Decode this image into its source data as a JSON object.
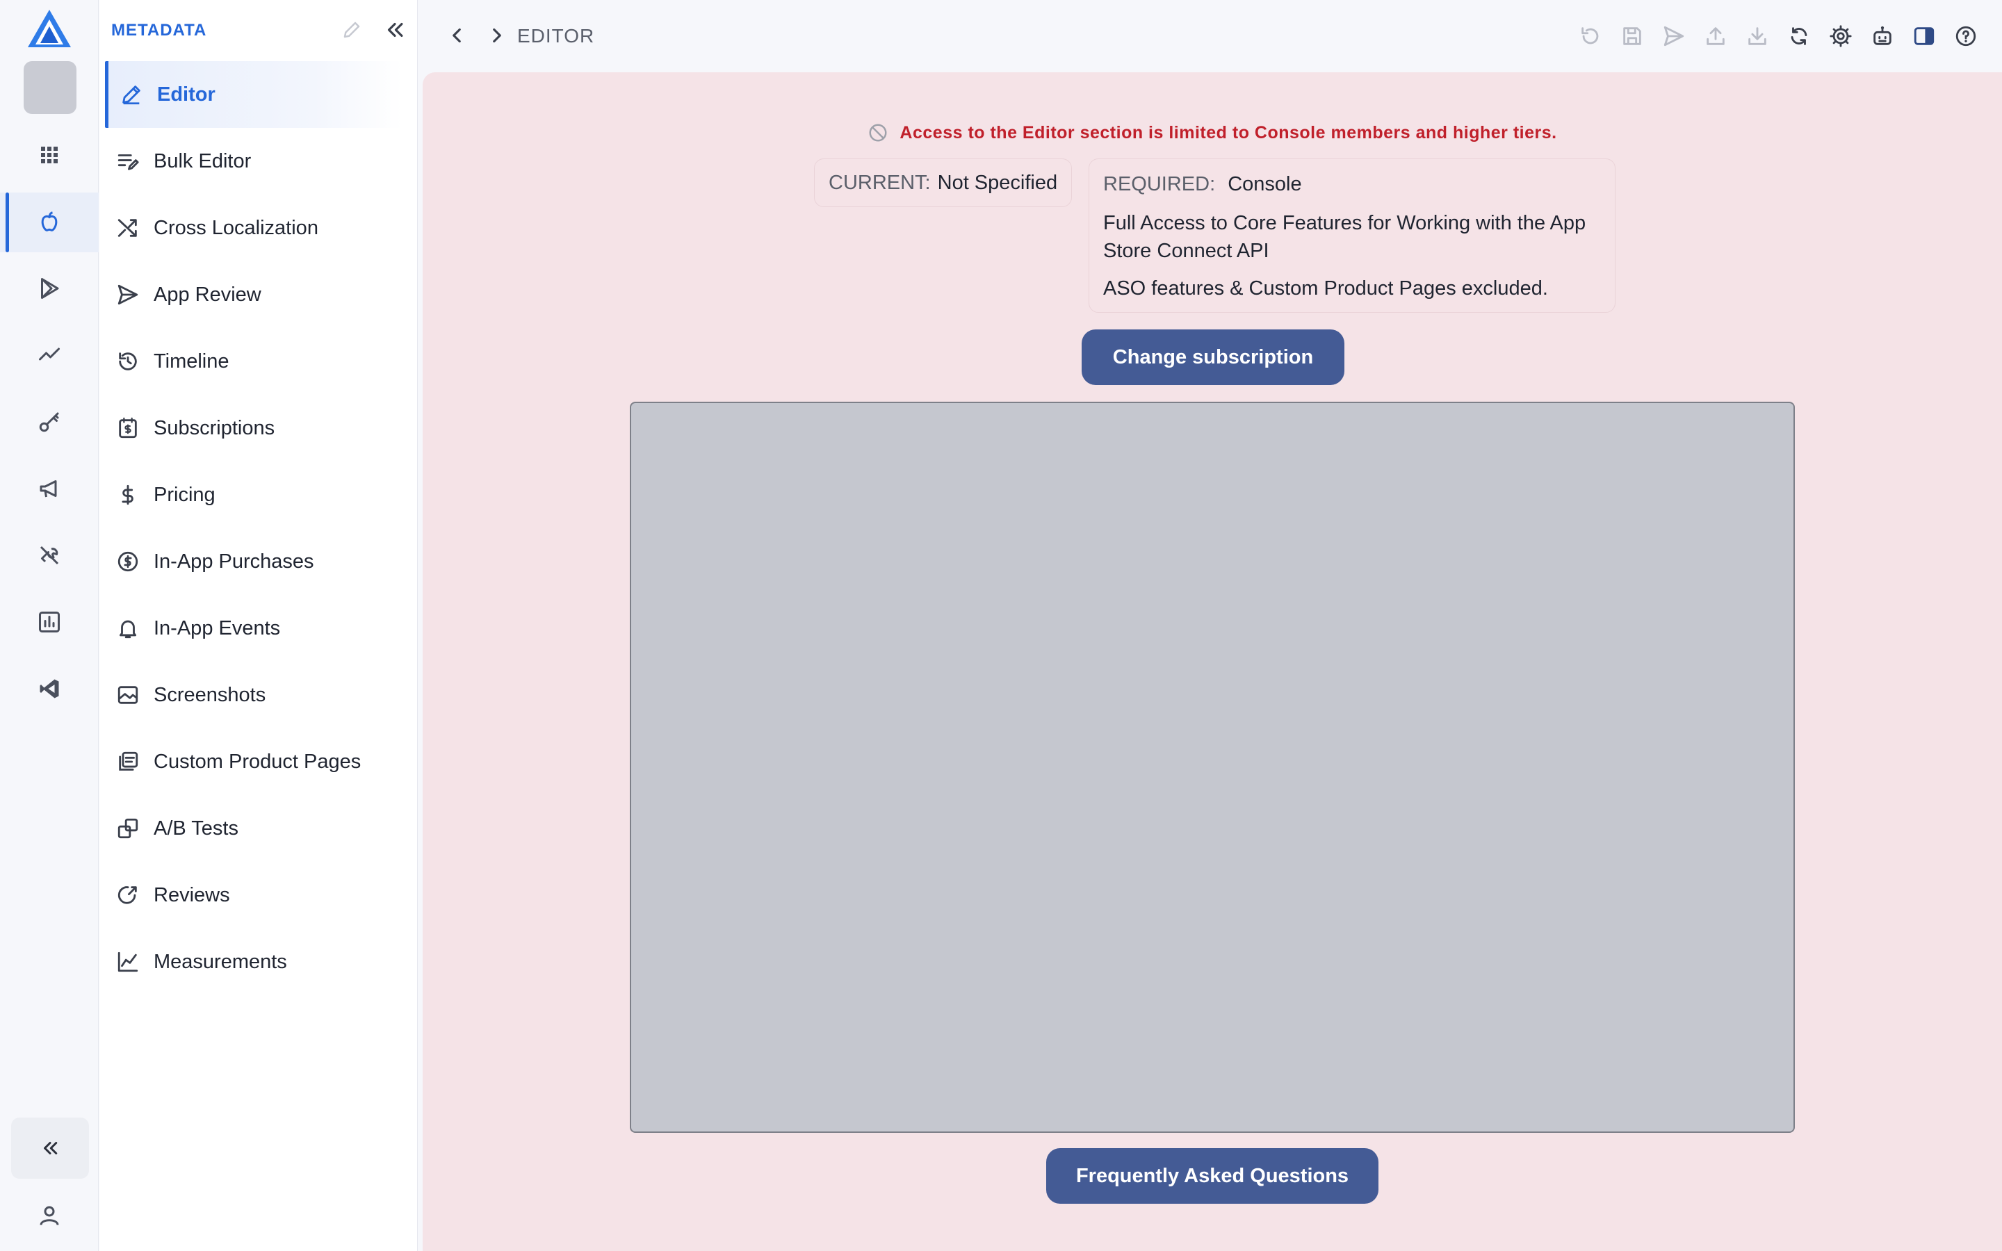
{
  "rail": {
    "logo_icon": "app-logo",
    "avatar_icon": "app-avatar-placeholder",
    "items": [
      {
        "icon": "apps-grid-icon",
        "active": false
      },
      {
        "icon": "apple-icon",
        "active": true
      },
      {
        "icon": "google-play-icon",
        "active": false
      },
      {
        "icon": "trend-icon",
        "active": false
      },
      {
        "icon": "key-icon",
        "active": false
      },
      {
        "icon": "megaphone-icon",
        "active": false
      },
      {
        "icon": "tools-icon",
        "active": false
      },
      {
        "icon": "bar-chart-icon",
        "active": false
      },
      {
        "icon": "vscode-icon",
        "active": false
      }
    ],
    "collapse_icon": "double-chevron-left-icon",
    "user_icon": "user-icon"
  },
  "sidebar": {
    "title": "METADATA",
    "items": [
      {
        "label": "Editor",
        "icon": "pencil-icon",
        "active": true
      },
      {
        "label": "Bulk Editor",
        "icon": "bulk-edit-icon",
        "active": false
      },
      {
        "label": "Cross Localization",
        "icon": "shuffle-icon",
        "active": false
      },
      {
        "label": "App Review",
        "icon": "send-icon",
        "active": false
      },
      {
        "label": "Timeline",
        "icon": "history-icon",
        "active": false
      },
      {
        "label": "Subscriptions",
        "icon": "subscriptions-icon",
        "active": false
      },
      {
        "label": "Pricing",
        "icon": "dollar-icon",
        "active": false
      },
      {
        "label": "In-App Purchases",
        "icon": "coin-icon",
        "active": false
      },
      {
        "label": "In-App Events",
        "icon": "bell-icon",
        "active": false
      },
      {
        "label": "Screenshots",
        "icon": "image-icon",
        "active": false
      },
      {
        "label": "Custom Product Pages",
        "icon": "pages-icon",
        "active": false
      },
      {
        "label": "A/B Tests",
        "icon": "ab-test-icon",
        "active": false
      },
      {
        "label": "Reviews",
        "icon": "review-icon",
        "active": false
      },
      {
        "label": "Measurements",
        "icon": "line-chart-icon",
        "active": false
      }
    ]
  },
  "topbar": {
    "breadcrumb": "EDITOR",
    "tools": [
      "undo-icon",
      "save-icon",
      "send-icon",
      "upload-icon",
      "download-icon",
      "refresh-icon",
      "settings-icon",
      "robot-icon",
      "panel-toggle-icon",
      "help-icon"
    ]
  },
  "main": {
    "alert_text": "Access to the Editor section is limited to Console members and higher tiers.",
    "current": {
      "label": "CURRENT:",
      "value": "Not Specified"
    },
    "required": {
      "label": "REQUIRED:",
      "value": "Console",
      "description": "Full Access to Core Features for Working with the App Store Connect API",
      "note": "ASO features & Custom Product Pages excluded."
    },
    "change_button": "Change subscription",
    "faq_button": "Frequently Asked Questions"
  },
  "colors": {
    "accent": "#2567d9",
    "main_bg": "#f5e3e7",
    "alert": "#c0202b",
    "button": "#445b95",
    "placeholder": "#c5c7cf"
  }
}
